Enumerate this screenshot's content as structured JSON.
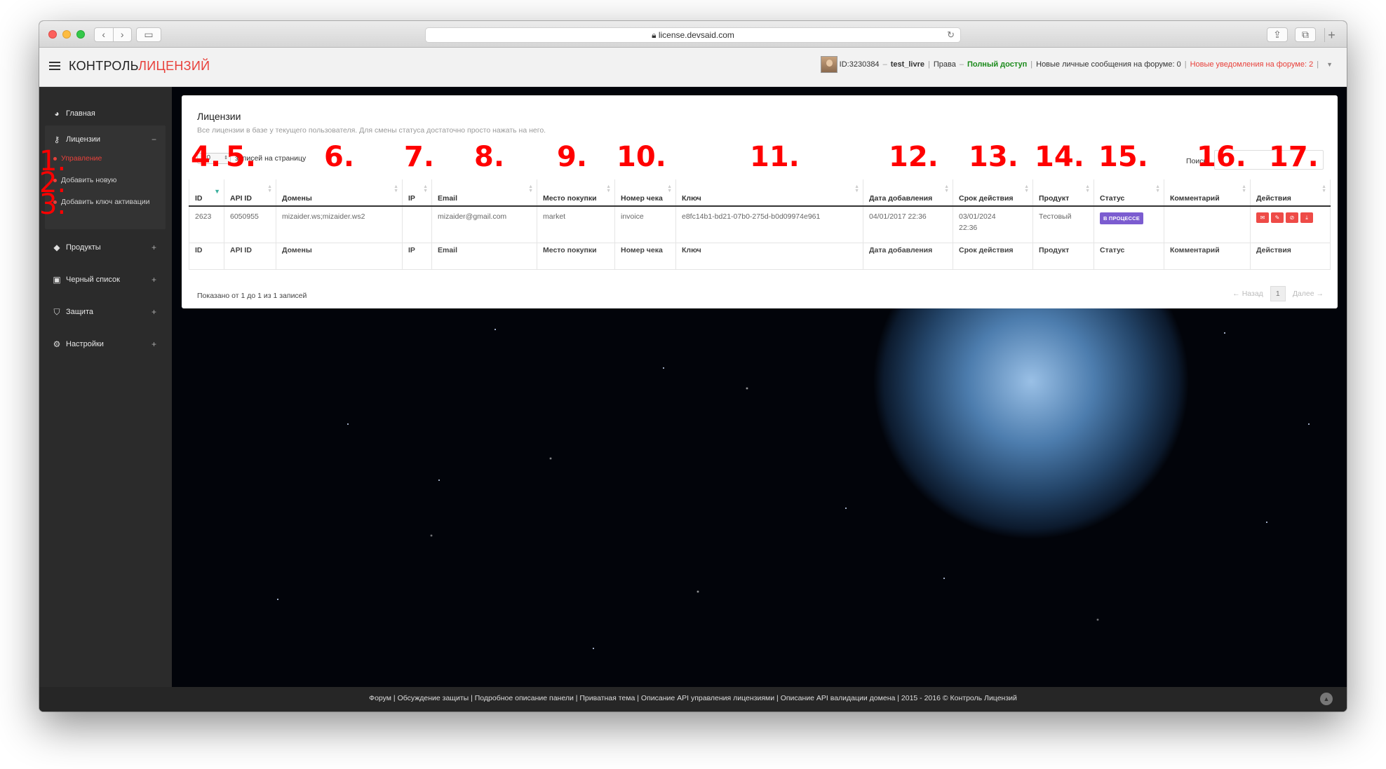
{
  "browser": {
    "url": "license.devsaid.com"
  },
  "header": {
    "brand_main": "КОНТРОЛЬ",
    "brand_accent": "ЛИЦЕНЗИЙ",
    "user_id": "ID:3230384",
    "username": "test_livre",
    "rights_label": "Права",
    "rights_value": "Полный доступ",
    "messages": "Новые личные сообщения на форуме: 0",
    "notifications": "Новые уведомления на форуме: 2"
  },
  "sidebar": {
    "home": "Главная",
    "licenses": "Лицензии",
    "licenses_toggle": "−",
    "sub": [
      "Управление",
      "Добавить новую",
      "Добавить ключ активации"
    ],
    "products": "Продукты",
    "blacklist": "Черный список",
    "protection": "Защита",
    "settings": "Настройки",
    "plus": "+"
  },
  "annotations": [
    "1.",
    "2.",
    "3.",
    "4.",
    "5.",
    "6.",
    "7.",
    "8.",
    "9.",
    "10.",
    "11.",
    "12.",
    "13.",
    "14.",
    "15.",
    "16.",
    "17."
  ],
  "panel": {
    "title": "Лицензии",
    "subtitle": "Все лицензии в базе у текущего пользователя. Для смены статуса достаточно просто нажать на него.",
    "page_length": "10",
    "page_length_label": "записей на страницу",
    "search_label": "Поиск:",
    "info": "Показано от 1 до 1 из 1 записей",
    "prev": "← Назад",
    "page": "1",
    "next": "Далее →"
  },
  "table": {
    "columns": [
      "ID",
      "API ID",
      "Домены",
      "IP",
      "Email",
      "Место покупки",
      "Номер чека",
      "Ключ",
      "Дата добавления",
      "Срок действия",
      "Продукт",
      "Статус",
      "Комментарий",
      "Действия"
    ],
    "row": {
      "id": "2623",
      "api_id": "6050955",
      "domains": "mizaider.ws;mizaider.ws2",
      "ip": "",
      "email": "mizaider@gmail.com",
      "place": "market",
      "receipt": "invoice",
      "key": "e8fc14b1-bd21-07b0-275d-b0d09974e961",
      "added": "04/01/2017 22:36",
      "expires": "03/01/2024 22:36",
      "product": "Тестовый",
      "status": "В ПРОЦЕССЕ",
      "comment": ""
    },
    "action_icons": [
      "envelope-icon",
      "edit-icon",
      "block-icon",
      "download-icon"
    ]
  },
  "footer": {
    "text": "Форум | Обсуждение защиты | Подробное описание панели | Приватная тема | Описание API управления лицензиями | Описание API валидации домена | 2015 - 2016 © Контроль Лицензий"
  },
  "colors": {
    "accent": "#e8413b",
    "status_badge": "#7b5cd0",
    "rights": "#1a8a1a"
  }
}
